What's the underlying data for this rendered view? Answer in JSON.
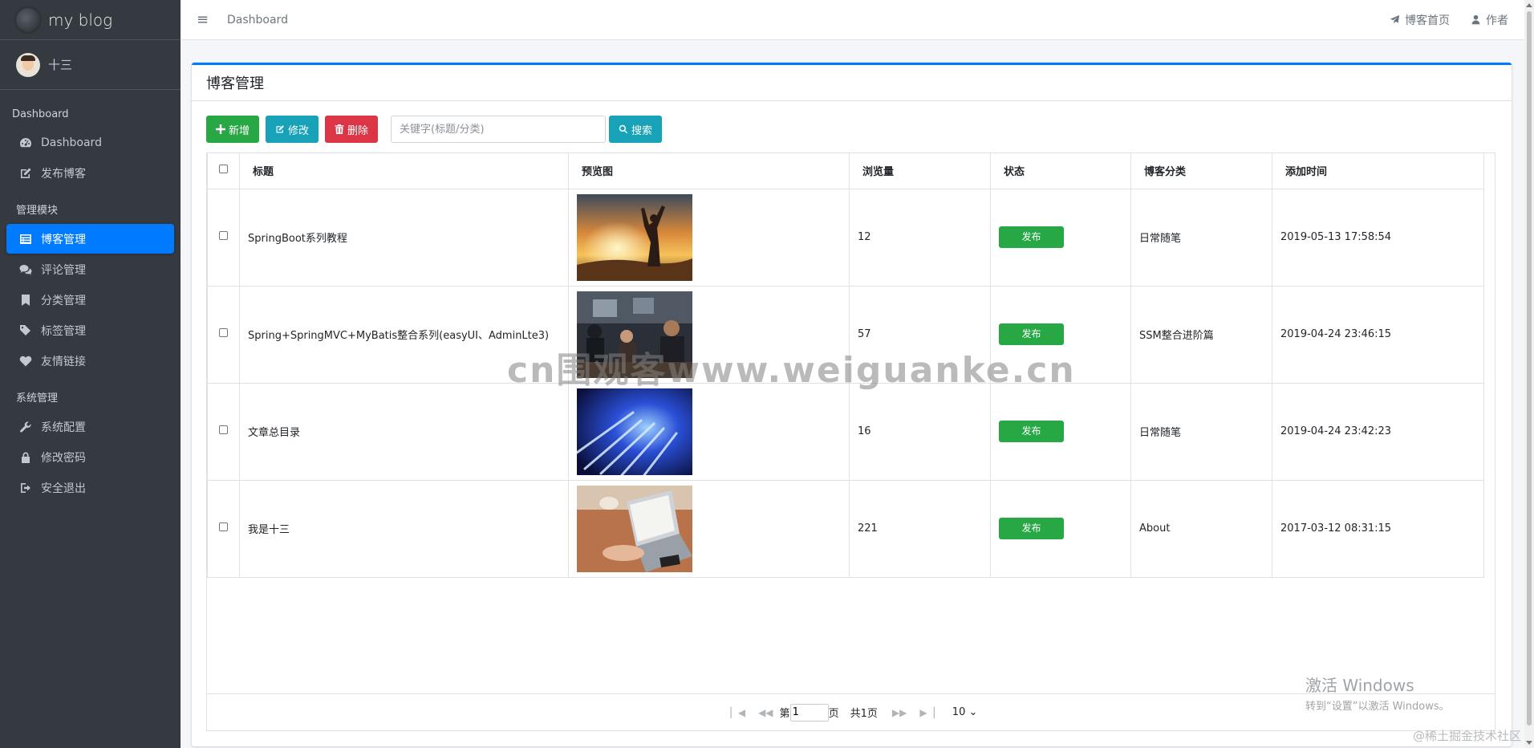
{
  "brand": {
    "name": "my blog"
  },
  "user": {
    "name": "十三"
  },
  "sidebar": {
    "sections": [
      {
        "header": "Dashboard",
        "items": [
          {
            "label": "Dashboard",
            "icon": "dashboard-icon"
          },
          {
            "label": "发布博客",
            "icon": "edit-icon"
          }
        ]
      },
      {
        "header": "管理模块",
        "items": [
          {
            "label": "博客管理",
            "icon": "list-icon",
            "active": true
          },
          {
            "label": "评论管理",
            "icon": "comments-icon"
          },
          {
            "label": "分类管理",
            "icon": "bookmark-icon"
          },
          {
            "label": "标签管理",
            "icon": "tags-icon"
          },
          {
            "label": "友情链接",
            "icon": "heart-icon"
          }
        ]
      },
      {
        "header": "系统管理",
        "items": [
          {
            "label": "系统配置",
            "icon": "wrench-icon"
          },
          {
            "label": "修改密码",
            "icon": "lock-icon"
          },
          {
            "label": "安全退出",
            "icon": "sign-out-icon"
          }
        ]
      }
    ]
  },
  "topbar": {
    "menu_icon": "≡",
    "breadcrumb": "Dashboard",
    "links": [
      {
        "label": "博客首页",
        "icon": "paper-plane-icon"
      },
      {
        "label": "作者",
        "icon": "user-icon"
      }
    ]
  },
  "card": {
    "title": "博客管理"
  },
  "toolbar": {
    "add_label": "新增",
    "edit_label": "修改",
    "delete_label": "删除",
    "search_placeholder": "关键字(标题/分类)",
    "search_label": "搜索"
  },
  "table": {
    "columns": [
      "标题",
      "预览图",
      "浏览量",
      "状态",
      "博客分类",
      "添加时间"
    ],
    "rows": [
      {
        "title": "SpringBoot系列教程",
        "views": "12",
        "status": "发布",
        "category": "日常随笔",
        "added": "2019-05-13 17:58:54",
        "thumb": "sunset"
      },
      {
        "title": "Spring+SpringMVC+MyBatis整合系列(easyUI、AdminLte3)",
        "views": "57",
        "status": "发布",
        "category": "SSM整合进阶篇",
        "added": "2019-04-24 23:46:15",
        "thumb": "office"
      },
      {
        "title": "文章总目录",
        "views": "16",
        "status": "发布",
        "category": "日常随笔",
        "added": "2019-04-24 23:42:23",
        "thumb": "fiber"
      },
      {
        "title": "我是十三",
        "views": "221",
        "status": "发布",
        "category": "About",
        "added": "2017-03-12 08:31:15",
        "thumb": "laptop"
      }
    ]
  },
  "pager": {
    "page_prefix": "第",
    "page_value": "1",
    "page_suffix": "页",
    "total": "共1页",
    "page_size": "10"
  },
  "overlays": {
    "watermark": "cn围观客www.weiguanke.cn",
    "activate_title": "激活 Windows",
    "activate_sub": "转到“设置”以激活 Windows。",
    "credit": "@稀土掘金技术社区"
  },
  "colors": {
    "primary": "#007bff",
    "success": "#28a745",
    "info": "#17a2b8",
    "danger": "#dc3545",
    "sidebar": "#343a40"
  }
}
